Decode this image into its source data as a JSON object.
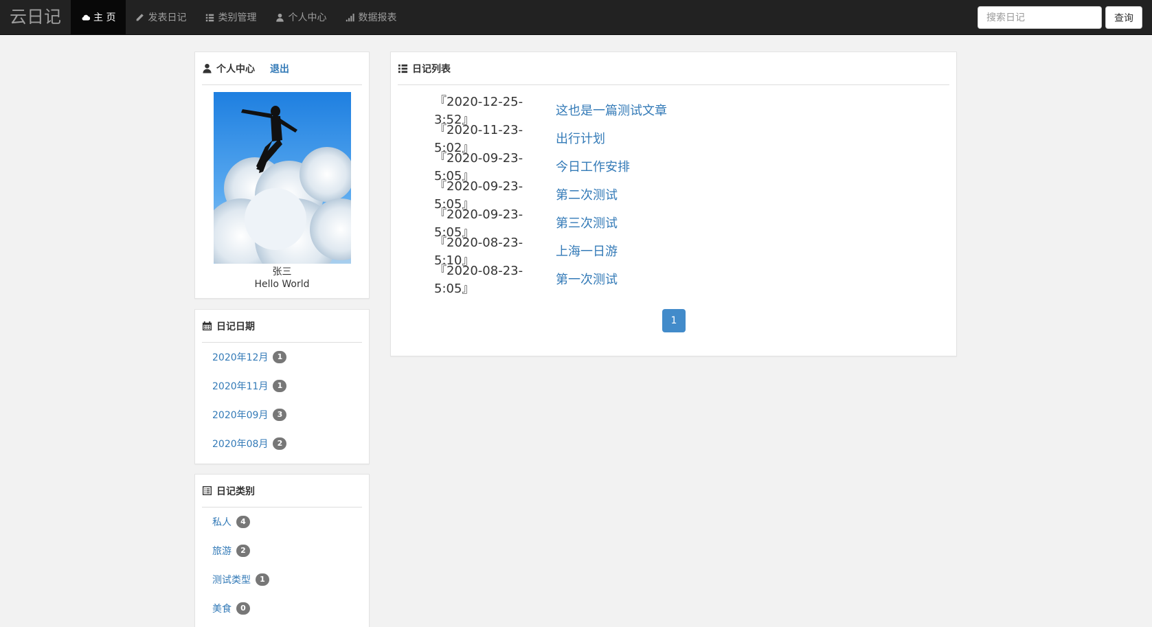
{
  "navbar": {
    "brand": "云日记",
    "items": [
      {
        "label": "主 页",
        "icon": "cloud-icon",
        "active": true
      },
      {
        "label": "发表日记",
        "icon": "pencil-icon",
        "active": false
      },
      {
        "label": "类别管理",
        "icon": "list-icon",
        "active": false
      },
      {
        "label": "个人中心",
        "icon": "user-icon",
        "active": false
      },
      {
        "label": "数据报表",
        "icon": "signal-icon",
        "active": false
      }
    ],
    "search_placeholder": "搜索日记",
    "search_button": "查询"
  },
  "profile": {
    "title": "个人中心",
    "logout": "退出",
    "name": "张三",
    "motto": "Hello World"
  },
  "dates": {
    "title": "日记日期",
    "items": [
      {
        "label": "2020年12月",
        "count": "1"
      },
      {
        "label": "2020年11月",
        "count": "1"
      },
      {
        "label": "2020年09月",
        "count": "3"
      },
      {
        "label": "2020年08月",
        "count": "2"
      }
    ]
  },
  "categories": {
    "title": "日记类别",
    "items": [
      {
        "label": "私人",
        "count": "4"
      },
      {
        "label": "旅游",
        "count": "2"
      },
      {
        "label": "测试类型",
        "count": "1"
      },
      {
        "label": "美食",
        "count": "0"
      }
    ]
  },
  "diary": {
    "title": "日记列表",
    "entries": [
      {
        "date": "『2020-12-25-3:52』",
        "title": "这也是一篇测试文章"
      },
      {
        "date": "『2020-11-23-5:02』",
        "title": "出行计划"
      },
      {
        "date": "『2020-09-23-5:05』",
        "title": "今日工作安排"
      },
      {
        "date": "『2020-09-23-5:05』",
        "title": "第二次测试"
      },
      {
        "date": "『2020-09-23-5:05』",
        "title": "第三次测试"
      },
      {
        "date": "『2020-08-23-5:10』",
        "title": "上海一日游"
      },
      {
        "date": "『2020-08-23-5:05』",
        "title": "第一次测试"
      }
    ],
    "page": "1"
  },
  "colors": {
    "navbar_bg": "#222222",
    "link": "#337ab7",
    "pager": "#428bca",
    "badge": "#777777"
  }
}
